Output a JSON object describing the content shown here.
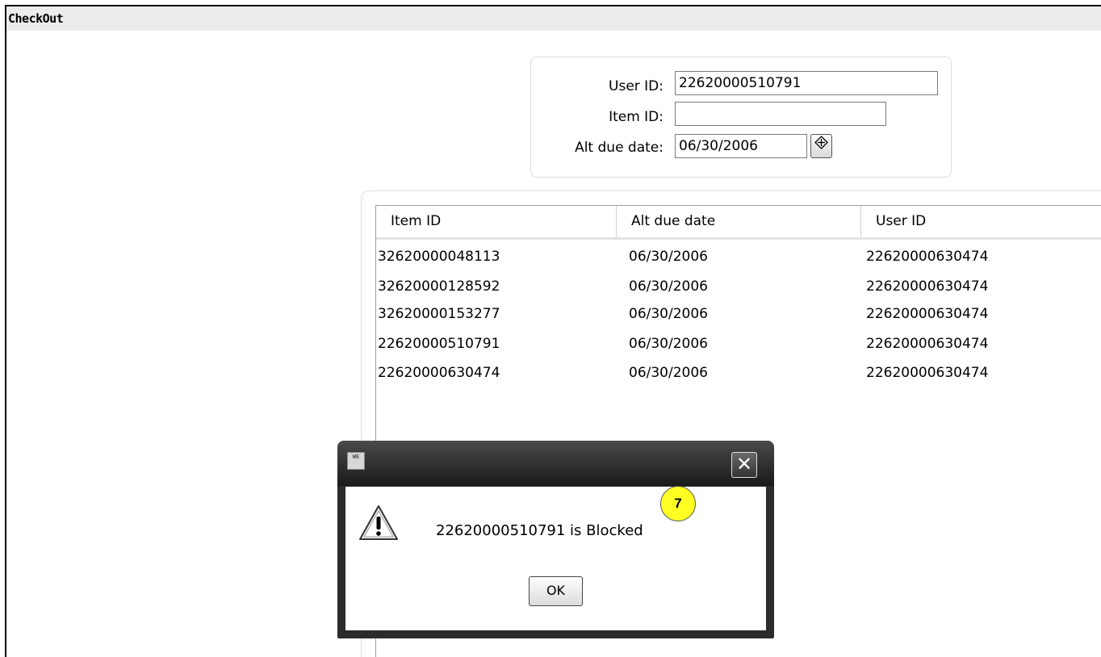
{
  "window": {
    "title": "CheckOut"
  },
  "form": {
    "user_id_label": "User ID:",
    "user_id_value": "22620000510791",
    "item_id_label": "Item ID:",
    "item_id_value": "",
    "alt_due_date_label": "Alt due date:",
    "alt_due_date_value": "06/30/2006"
  },
  "grid": {
    "columns": [
      "Item ID",
      "Alt due date",
      "User ID"
    ],
    "rows": [
      [
        "32620000048113",
        "06/30/2006",
        "22620000630474"
      ],
      [
        "32620000128592",
        "06/30/2006",
        "22620000630474"
      ],
      [
        "32620000153277",
        "06/30/2006",
        "22620000630474"
      ],
      [
        "22620000510791",
        "06/30/2006",
        "22620000630474"
      ],
      [
        "22620000630474",
        "06/30/2006",
        "22620000630474"
      ]
    ]
  },
  "dialog": {
    "app_icon_text": "WE",
    "close_glyph": "✕",
    "message": "22620000510791 is Blocked",
    "ok_label": "OK",
    "callout_number": "7",
    "callout_color": "#ffff24"
  },
  "icons": {
    "calendar": "calendar-icon",
    "warning": "warning-icon",
    "close": "close-icon"
  }
}
